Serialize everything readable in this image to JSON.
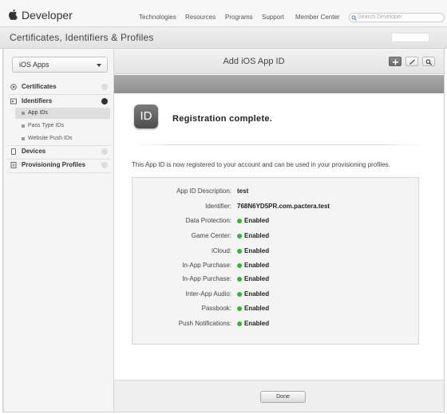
{
  "topnav": {
    "brand": "Developer",
    "links": [
      "Technologies",
      "Resources",
      "Programs",
      "Support",
      "Member Center"
    ],
    "search_placeholder": "Search Developer"
  },
  "titlebar": {
    "title": "Certificates, Identifiers & Profiles"
  },
  "sidebar": {
    "select_value": "iOS Apps",
    "sections": [
      {
        "label": "Certificates",
        "icon": "certificate-icon"
      },
      {
        "label": "Identifiers",
        "icon": "id-card-icon",
        "expanded": true,
        "items": [
          "App IDs",
          "Pass Type IDs",
          "Website Push IDs"
        ],
        "active_item": "App IDs"
      },
      {
        "label": "Devices",
        "icon": "device-icon"
      },
      {
        "label": "Provisioning Profiles",
        "icon": "profile-doc-icon"
      }
    ]
  },
  "main": {
    "header_title": "Add iOS App ID",
    "header_buttons": [
      "add-icon",
      "edit-icon",
      "search-icon"
    ],
    "badge_text": "ID",
    "heading": "Registration complete.",
    "message": "This App ID is now registered to your account and can be used in your provisioning profiles.",
    "details": [
      {
        "label": "App ID Description:",
        "value": "test"
      },
      {
        "label": "Identifier:",
        "value": "768N6YD5PR.com.pactera.test"
      },
      {
        "label": "Data Protection:",
        "value": "Enabled",
        "status": true
      },
      {
        "label": "Game Center:",
        "value": "Enabled",
        "status": true
      },
      {
        "label": "iCloud:",
        "value": "Enabled",
        "status": true
      },
      {
        "label": "In-App Purchase:",
        "value": "Enabled",
        "status": true
      },
      {
        "label": "In-App Purchase:",
        "value": "Enabled",
        "status": true
      },
      {
        "label": "Inter-App Audio:",
        "value": "Enabled",
        "status": true
      },
      {
        "label": "Passbook:",
        "value": "Enabled",
        "status": true
      },
      {
        "label": "Push Notifications:",
        "value": "Enabled",
        "status": true
      }
    ],
    "status_color": "#2eb82e",
    "done_label": "Done"
  }
}
